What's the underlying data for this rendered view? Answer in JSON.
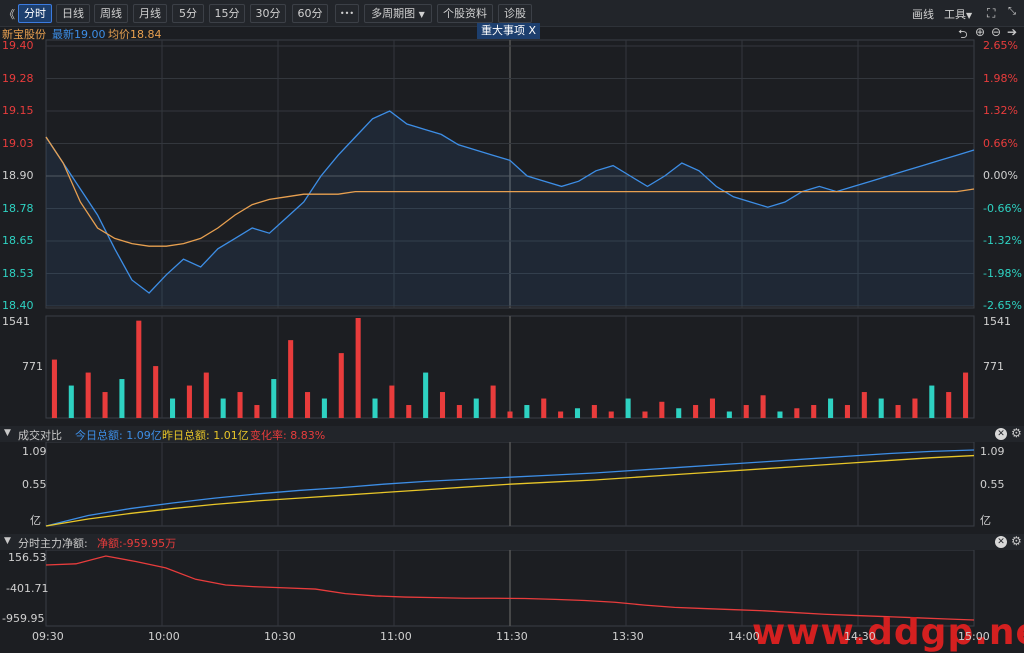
{
  "toolbar": {
    "back": "《",
    "tabs": [
      "分时",
      "日线",
      "周线",
      "月线",
      "5分",
      "15分",
      "30分",
      "60分"
    ],
    "active_tab": "分时",
    "more": "•••",
    "multi_period": "多周期图",
    "stock_info": "个股资料",
    "diagnose": "诊股",
    "draw": "画线",
    "tools": "工具"
  },
  "info": {
    "stock_name": "新宝股份",
    "latest": "最新19.00",
    "avg": "均价18.84",
    "event": "重大事项",
    "event_close": "X"
  },
  "colors": {
    "price": "#3d8ee6",
    "avg": "#e8a050",
    "up": "#e83c3c",
    "down": "#2ed2c2",
    "today": "#3d8ee6",
    "yesterday": "#e8c628",
    "netflow": "#e83c3c"
  },
  "chart_data": [
    {
      "type": "line",
      "title": "新宝股份 分时",
      "ylim": [
        18.4,
        19.4
      ],
      "ytick_labels": [
        "19.40",
        "19.28",
        "19.15",
        "19.03",
        "18.90",
        "18.78",
        "18.65",
        "18.53",
        "18.40"
      ],
      "pct_labels": [
        "2.65%",
        "1.98%",
        "1.32%",
        "0.66%",
        "0.00%",
        "-0.66%",
        "-1.32%",
        "-1.98%",
        "-2.65%"
      ],
      "xtick_labels": [
        "09:30",
        "10:00",
        "10:30",
        "11:00",
        "11:30",
        "13:30",
        "14:00",
        "14:30",
        "15:00"
      ],
      "series": [
        {
          "name": "最新",
          "values": [
            19.05,
            18.95,
            18.85,
            18.75,
            18.62,
            18.5,
            18.45,
            18.52,
            18.58,
            18.55,
            18.62,
            18.66,
            18.7,
            18.68,
            18.74,
            18.8,
            18.9,
            18.98,
            19.05,
            19.12,
            19.15,
            19.1,
            19.08,
            19.06,
            19.02,
            19.0,
            18.98,
            18.96,
            18.9,
            18.88,
            18.86,
            18.88,
            18.92,
            18.94,
            18.9,
            18.86,
            18.9,
            18.95,
            18.92,
            18.86,
            18.82,
            18.8,
            18.78,
            18.8,
            18.84,
            18.86,
            18.84,
            18.86,
            18.88,
            18.9,
            18.92,
            18.94,
            18.96,
            18.98,
            19.0
          ]
        },
        {
          "name": "均价",
          "values": [
            19.05,
            18.95,
            18.8,
            18.7,
            18.66,
            18.64,
            18.63,
            18.63,
            18.64,
            18.66,
            18.7,
            18.75,
            18.79,
            18.81,
            18.82,
            18.83,
            18.83,
            18.83,
            18.84,
            18.84,
            18.84,
            18.84,
            18.84,
            18.84,
            18.84,
            18.84,
            18.84,
            18.84,
            18.84,
            18.84,
            18.84,
            18.84,
            18.84,
            18.84,
            18.84,
            18.84,
            18.84,
            18.84,
            18.84,
            18.84,
            18.84,
            18.84,
            18.84,
            18.84,
            18.84,
            18.84,
            18.84,
            18.84,
            18.84,
            18.84,
            18.84,
            18.84,
            18.84,
            18.84,
            18.85
          ]
        }
      ]
    },
    {
      "type": "bar",
      "title": "成交量",
      "ylim": [
        0,
        1541
      ],
      "ytick_labels": [
        "1541",
        "771"
      ],
      "values": [
        900,
        500,
        700,
        400,
        600,
        1500,
        800,
        300,
        500,
        700,
        300,
        400,
        200,
        600,
        1200,
        400,
        300,
        1000,
        1541,
        300,
        500,
        200,
        700,
        400,
        200,
        300,
        500,
        100,
        200,
        300,
        100,
        150,
        200,
        100,
        300,
        100,
        250,
        150,
        200,
        300,
        100,
        200,
        350,
        100,
        150,
        200,
        300,
        200,
        400,
        300,
        200,
        300,
        500,
        400,
        700
      ]
    },
    {
      "type": "line",
      "title": "成交对比",
      "ytick_labels": [
        "1.09",
        "0.55",
        "亿"
      ],
      "series": [
        {
          "name": "今日总额",
          "values": [
            0.0,
            0.15,
            0.25,
            0.33,
            0.4,
            0.46,
            0.51,
            0.55,
            0.6,
            0.64,
            0.67,
            0.7,
            0.73,
            0.76,
            0.8,
            0.84,
            0.88,
            0.92,
            0.96,
            1.0,
            1.04,
            1.07,
            1.09
          ]
        },
        {
          "name": "昨日总额",
          "values": [
            0.0,
            0.1,
            0.18,
            0.25,
            0.31,
            0.36,
            0.4,
            0.44,
            0.48,
            0.52,
            0.56,
            0.6,
            0.63,
            0.66,
            0.7,
            0.74,
            0.78,
            0.82,
            0.86,
            0.9,
            0.94,
            0.98,
            1.01
          ]
        }
      ]
    },
    {
      "type": "line",
      "title": "分时主力净额",
      "ytick_labels": [
        "156.53",
        "-401.71",
        "-959.95"
      ],
      "series": [
        {
          "name": "净额",
          "values": [
            0,
            20,
            156,
            60,
            -50,
            -250,
            -350,
            -380,
            -400,
            -420,
            -500,
            -540,
            -560,
            -570,
            -580,
            -580,
            -585,
            -600,
            -620,
            -650,
            -700,
            -740,
            -760,
            -780,
            -800,
            -830,
            -860,
            -880,
            -900,
            -920,
            -940,
            -959.95
          ]
        }
      ]
    }
  ],
  "panels": {
    "volume_compare": {
      "title": "成交对比",
      "today": "今日总额: 1.09亿",
      "yesterday": "昨日总额: 1.01亿",
      "change": "变化率: 8.83%"
    },
    "netflow": {
      "title": "分时主力净额:",
      "net": "净额:-959.95万"
    }
  },
  "watermark": "www.ddgp.net"
}
